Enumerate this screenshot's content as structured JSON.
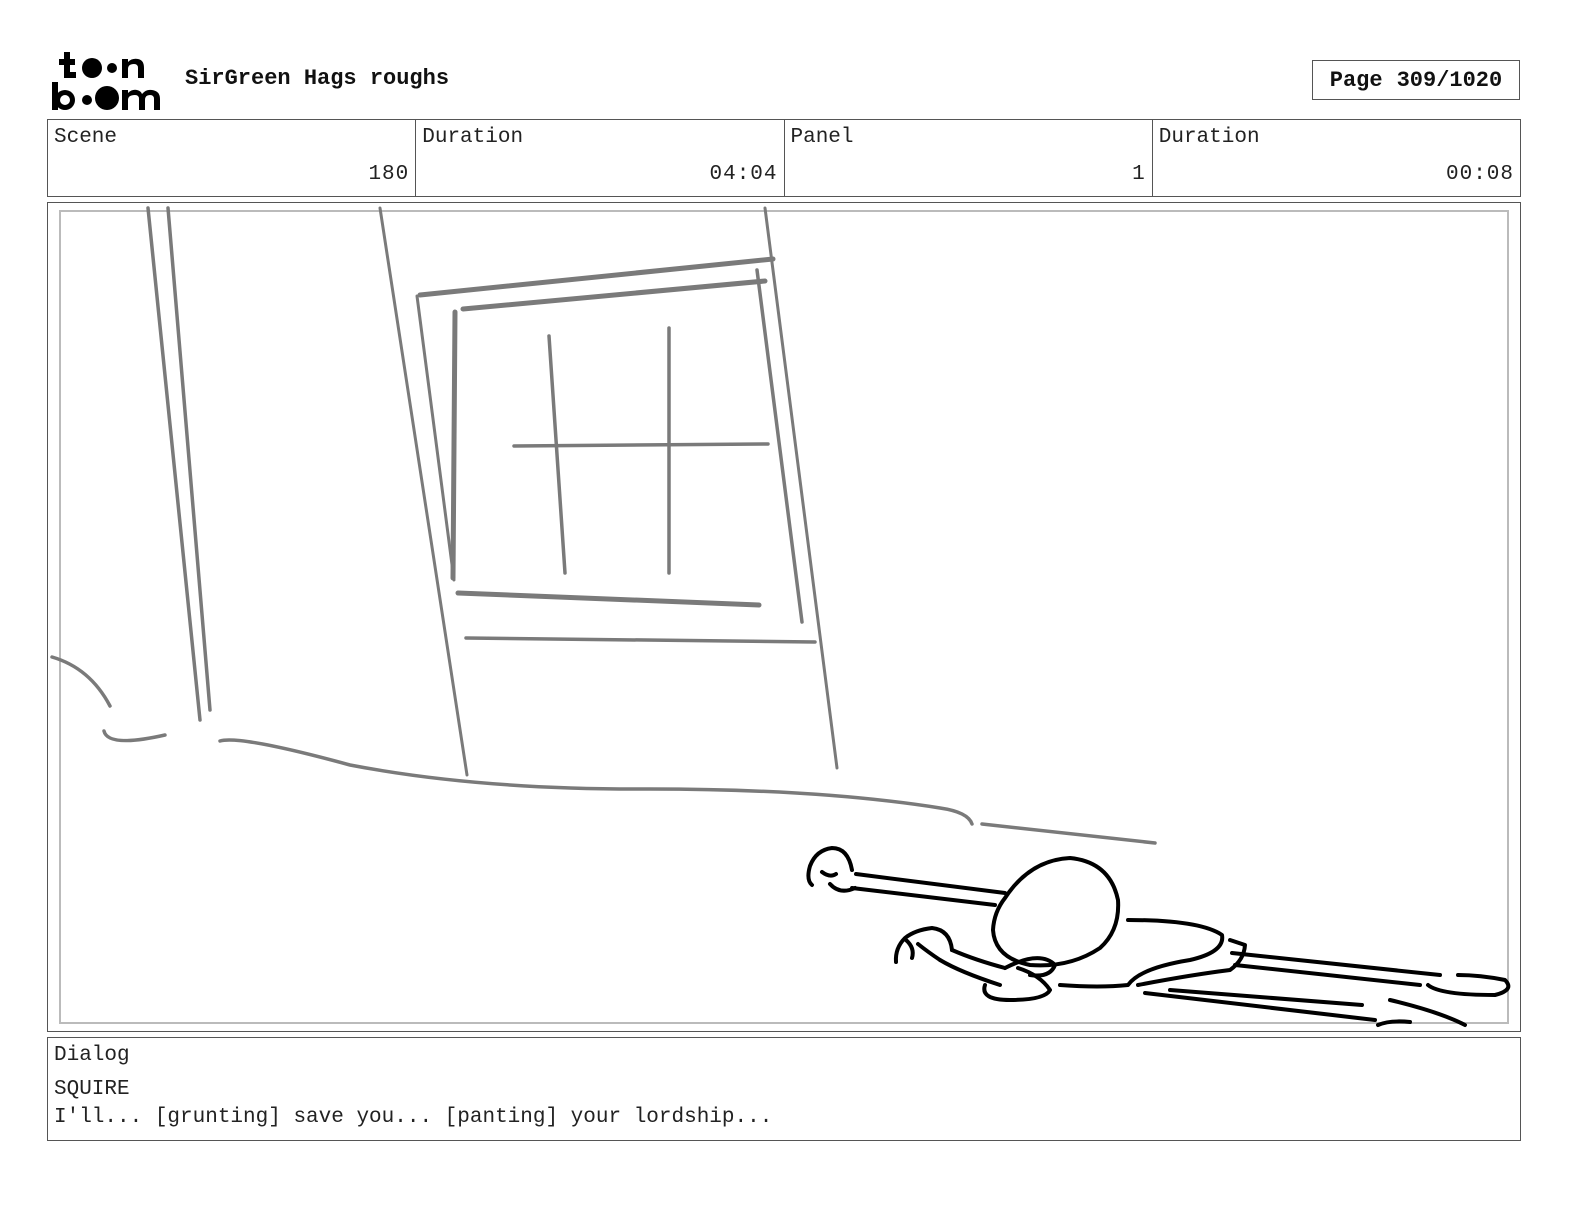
{
  "header": {
    "logo_text": "toon boom",
    "project_title": "SirGreen Hags roughs",
    "page_label": "Page",
    "page_value": "309/1020"
  },
  "info": {
    "scene_label": "Scene",
    "scene_value": "180",
    "scene_duration_label": "Duration",
    "scene_duration_value": "04:04",
    "panel_label": "Panel",
    "panel_value": "1",
    "panel_duration_label": "Duration",
    "panel_duration_value": "00:08"
  },
  "dialog": {
    "label": "Dialog",
    "speaker": "SQUIRE",
    "line": "I'll... [grunting] save you... [panting] your lordship..."
  },
  "colors": {
    "background_sketch": "#7a7a7a",
    "character_sketch": "#000000",
    "frame_border": "#555555"
  }
}
